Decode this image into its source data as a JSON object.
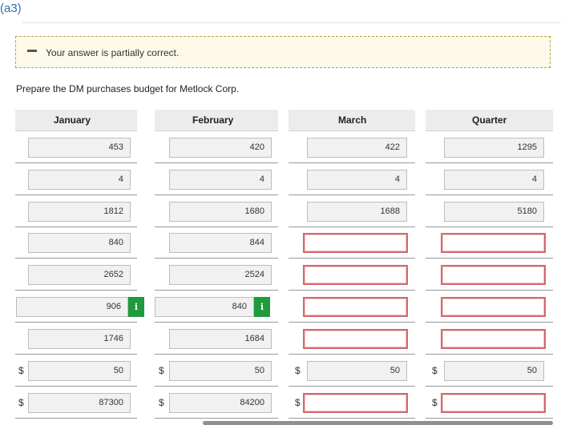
{
  "part_label": "(a3)",
  "notice": {
    "message": "Your answer is partially correct."
  },
  "instruction": "Prepare the DM purchases budget for Metlock Corp.",
  "columns": [
    "January",
    "February",
    "March",
    "Quarter"
  ],
  "currency_symbol": "$",
  "rows": [
    {
      "values": [
        "453",
        "420",
        "422",
        "1295"
      ],
      "status": [
        "ok",
        "ok",
        "ok",
        "ok"
      ]
    },
    {
      "values": [
        "4",
        "4",
        "4",
        "4"
      ],
      "status": [
        "ok",
        "ok",
        "ok",
        "ok"
      ]
    },
    {
      "values": [
        "1812",
        "1680",
        "1688",
        "5180"
      ],
      "status": [
        "ok",
        "ok",
        "ok",
        "ok"
      ]
    },
    {
      "values": [
        "840",
        "844",
        "",
        ""
      ],
      "status": [
        "ok",
        "ok",
        "incorrect",
        "incorrect"
      ]
    },
    {
      "values": [
        "2652",
        "2524",
        "",
        ""
      ],
      "status": [
        "ok",
        "ok",
        "incorrect",
        "incorrect"
      ]
    },
    {
      "values": [
        "906",
        "840",
        "",
        ""
      ],
      "status": [
        "ok",
        "ok",
        "incorrect",
        "incorrect"
      ],
      "info_icon_label": "i"
    },
    {
      "values": [
        "1746",
        "1684",
        "",
        ""
      ],
      "status": [
        "ok",
        "ok",
        "incorrect",
        "incorrect"
      ]
    },
    {
      "values": [
        "50",
        "50",
        "50",
        "50"
      ],
      "status": [
        "ok",
        "ok",
        "ok",
        "ok"
      ],
      "dollar": true
    },
    {
      "values": [
        "87300",
        "84200",
        "",
        ""
      ],
      "status": [
        "ok",
        "ok",
        "incorrect",
        "incorrect"
      ],
      "dollar": true
    }
  ],
  "colors": {
    "accent": "#2e6fb0",
    "notice_border": "#b5a032",
    "error_border": "#d26a6a",
    "info_green": "#1f9a3c"
  }
}
